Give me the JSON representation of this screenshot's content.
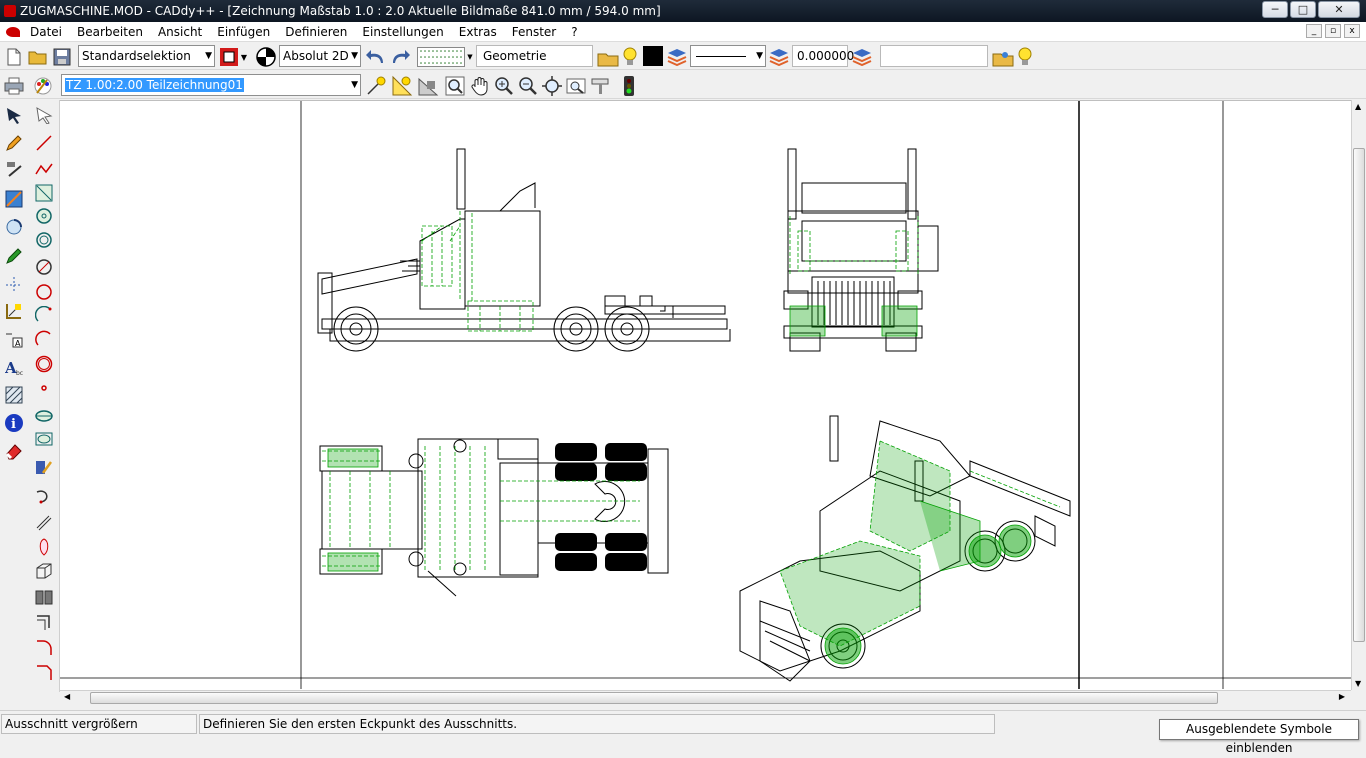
{
  "window": {
    "title": "ZUGMASCHINE.MOD  -  CADdy++ - [Zeichnung   Maßstab 1.0 : 2.0   Aktuelle Bildmaße 841.0 mm / 594.0 mm]",
    "minimize_label": "─",
    "maximize_label": "□",
    "close_label": "✕"
  },
  "menu": {
    "items": [
      "Datei",
      "Bearbeiten",
      "Ansicht",
      "Einfügen",
      "Definieren",
      "Einstellungen",
      "Extras",
      "Fenster",
      "?"
    ],
    "mdi_buttons": [
      "_",
      "▫",
      "x"
    ]
  },
  "toolbar1": {
    "selection_mode": "Standardselektion",
    "coord_mode": "Absolut 2D",
    "layer_name": "Geometrie",
    "line_width": "0.000000",
    "empty_field": ""
  },
  "toolbar2": {
    "drawing_name": "TZ 1.00:2.00 Teilzeichnung01"
  },
  "status": {
    "command": "Ausschnitt vergrößern",
    "prompt": "Definieren Sie den ersten Eckpunkt des Ausschnitts.",
    "tooltip": "Ausgeblendete Symbole einblenden"
  },
  "colors": {
    "drawing_line": "#000000",
    "hatch": "#00a000",
    "titlebar": "#14202e",
    "accent_red": "#cc0000"
  }
}
